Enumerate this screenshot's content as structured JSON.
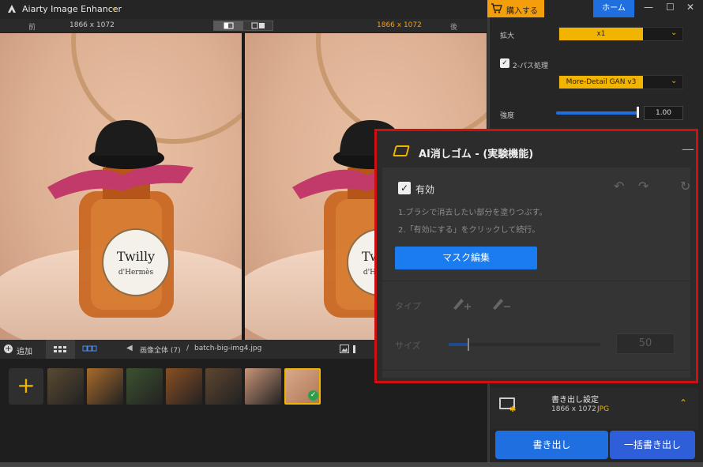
{
  "app": {
    "title": "Aiarty Image Enhancer",
    "title_chevron": "⌄"
  },
  "compare": {
    "before_label": "前",
    "after_label": "後",
    "left_resolution": "1866 x 1072",
    "right_resolution": "1866 x 1072"
  },
  "bottombar": {
    "add_label": "追加",
    "crumb_all": "画像全体 (7)",
    "crumb_sep": "/",
    "crumb_file": "batch-big-img4.jpg"
  },
  "header": {
    "buy_label": "購入する",
    "home_label": "ホーム",
    "win_min": "—",
    "win_max": "☐",
    "win_close": "✕"
  },
  "settings": {
    "scale_label": "拡大",
    "scale_value": "x1",
    "twopass_label": "2-パス処理",
    "twopass_checked": "✓",
    "model_value": "More-Detail GAN  v3",
    "strength_label": "強度",
    "strength_value": "1.00",
    "strength_level": 1.0
  },
  "eraser": {
    "title": "AI消しゴム - (実験機能)",
    "collapse": "—",
    "enable_label": "有効",
    "enable_checked": "✓",
    "step1": "1.ブラシで消去したい部分を塗りつぶす。",
    "step2": "2.「有効にする」をクリックして続行。",
    "mask_button": "マスク編集",
    "type_label": "タイプ",
    "size_label": "サイズ",
    "size_value": "50",
    "undo_icon": "↶",
    "redo_icon": "↷",
    "reset_icon": "↻"
  },
  "export": {
    "title": "書き出し設定",
    "resolution": "1866 x 1072",
    "format": "JPG",
    "export_button": "書き出し",
    "batch_button": "一括書き出し"
  },
  "thumbnails": [
    {
      "name": "butterfly",
      "color": "#5a4a32"
    },
    {
      "name": "tiger",
      "color": "#a86a2c"
    },
    {
      "name": "potion",
      "color": "#3c5230"
    },
    {
      "name": "burger",
      "color": "#8a4f22"
    },
    {
      "name": "dog",
      "color": "#5e4630"
    },
    {
      "name": "woman",
      "color": "#c89478"
    },
    {
      "name": "perfume",
      "color": "#d8a88a"
    }
  ],
  "colors": {
    "accent": "#f1b400",
    "primary": "#1f6fe0",
    "highlight_border": "#d01010"
  }
}
